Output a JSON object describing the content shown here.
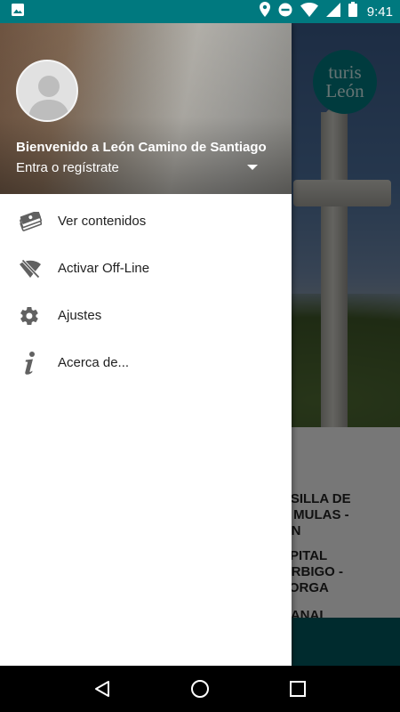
{
  "status_bar": {
    "time": "9:41"
  },
  "background": {
    "logo_line1": "turis",
    "logo_line2": "León",
    "routes": [
      "NSILLA DE\nS MULAS -\nÓN",
      "SPITAL\nÓRBIGO -\nTORGA",
      "BANAL"
    ]
  },
  "drawer": {
    "welcome_title": "Bienvenido a León Camino de Santiago",
    "account_prompt": "Entra o regístrate",
    "menu": [
      {
        "label": "Ver contenidos",
        "icon": "stack-money-icon"
      },
      {
        "label": "Activar Off-Line",
        "icon": "wifi-off-icon"
      },
      {
        "label": "Ajustes",
        "icon": "gear-icon"
      },
      {
        "label": "Acerca de...",
        "icon": "info-icon"
      }
    ]
  },
  "colors": {
    "status_bar": "#00797f",
    "drawer_bg": "#ffffff",
    "icon": "#606060",
    "bottom_bar": "#01575c"
  }
}
